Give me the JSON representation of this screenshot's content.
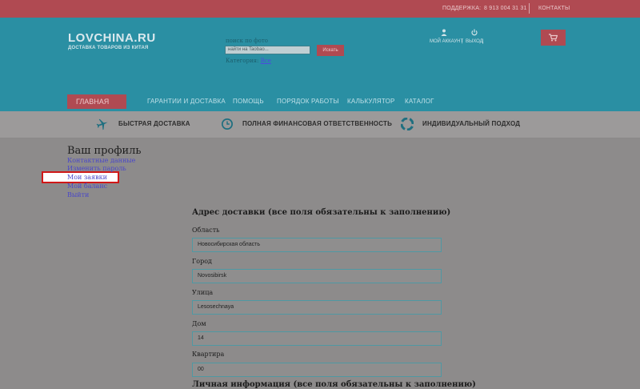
{
  "topbar": {
    "support_label": "ПОДДЕРЖКА:",
    "phone": "8 913 004 31 31",
    "contacts": "КОНТАКТЫ"
  },
  "header": {
    "logo": "LOVCHINA.RU",
    "tagline": "ДОСТАВКА ТОВАРОВ ИЗ КИТАЯ",
    "search_hint": "поиск по фото",
    "search_placeholder": "найти на Taobao...",
    "search_button": "Искать",
    "category_label": "Категория:",
    "category_value": "Все",
    "account_label": "МОЙ АККАУНТ",
    "logout_label": "ВЫХОД",
    "account_sep": "|"
  },
  "nav": {
    "main": "ГЛАВНАЯ",
    "items": [
      "ГАРАНТИИ И ДОСТАВКА",
      "ПОМОЩЬ",
      "ПОРЯДОК РАБОТЫ",
      "КАЛЬКУЛЯТОР",
      "КАТАЛОГ"
    ]
  },
  "features": [
    "БЫСТРАЯ ДОСТАВКА",
    "ПОЛНАЯ ФИНАНСОВАЯ ОТВЕТСТВЕННОСТЬ",
    "ИНДИВИДУАЛЬНЫЙ ПОДХОД"
  ],
  "profile": {
    "title": "Ваш профиль",
    "menu": [
      "Контактные данные",
      "Изменить пароль",
      "Мои заявки",
      "Мой баланс",
      "Выйти"
    ]
  },
  "address": {
    "title": "Адрес доставки (все поля обязательны к заполнению)",
    "fields": [
      {
        "label": "Область",
        "value": "Новосибирская область"
      },
      {
        "label": "Город",
        "value": "Novosibirsk"
      },
      {
        "label": "Улица",
        "value": "Lesosechnaya"
      },
      {
        "label": "Дом",
        "value": "14"
      },
      {
        "label": "Квартира",
        "value": "00"
      }
    ]
  },
  "personal": {
    "title": "Личная информация (все поля обязательны к заполнению)"
  },
  "colors": {
    "topbar": "#b04a52",
    "header": "#2a8fa3",
    "accent": "#b04a52",
    "highlight": "#d01818"
  }
}
